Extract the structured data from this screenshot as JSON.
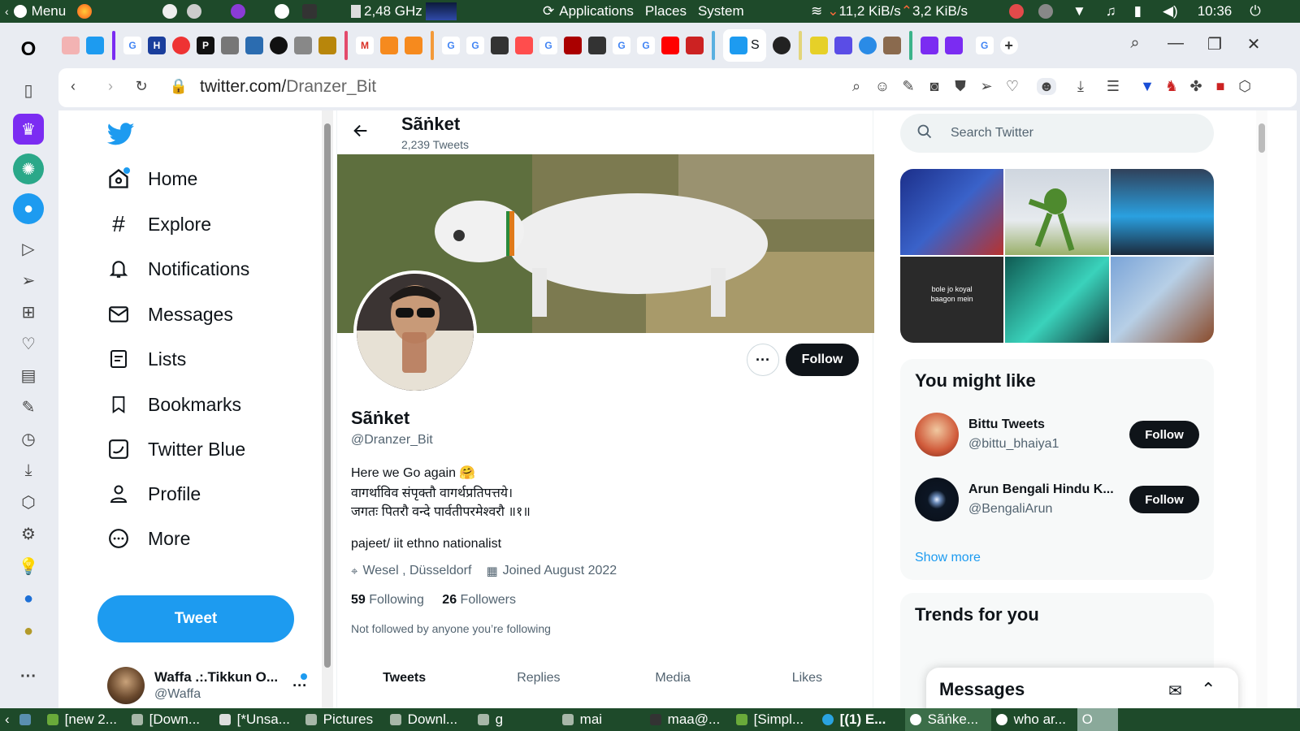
{
  "os_top": {
    "menu_label": "Menu",
    "cpu": "2,48 GHz",
    "applications": "Applications",
    "places": "Places",
    "system": "System",
    "net_down": "11,2 KiB/s",
    "net_up": "3,2 KiB/s",
    "clock": "10:36"
  },
  "browser": {
    "url_host": "twitter.com/",
    "url_path": "Dranzer_Bit",
    "active_tab_letter": "S"
  },
  "nav": {
    "items": [
      {
        "label": "Home",
        "icon": "home-icon"
      },
      {
        "label": "Explore",
        "icon": "hashtag-icon"
      },
      {
        "label": "Notifications",
        "icon": "bell-icon"
      },
      {
        "label": "Messages",
        "icon": "envelope-icon"
      },
      {
        "label": "Lists",
        "icon": "list-icon"
      },
      {
        "label": "Bookmarks",
        "icon": "bookmark-icon"
      },
      {
        "label": "Twitter Blue",
        "icon": "twitter-blue-icon"
      },
      {
        "label": "Profile",
        "icon": "person-icon"
      },
      {
        "label": "More",
        "icon": "more-circle-icon"
      }
    ],
    "tweet_button": "Tweet",
    "account_name": "Waffa .:.Tikkun O...",
    "account_handle": "@Waffa"
  },
  "profile": {
    "header_name": "Sãṅket",
    "tweet_count": "2,239 Tweets",
    "name": "Sãṅket",
    "handle": "@Dranzer_Bit",
    "follow_label": "Follow",
    "bio_line1": "Here we Go again 🤗",
    "bio_line2": "वागर्थाविव संपृक्तौ वागर्थप्रतिपत्तये।",
    "bio_line3": "जगतः पितरौ वन्दे पार्वतीपरमेश्वरौ ॥१॥",
    "bio_line4": "pajeet/ iit ethno nationalist",
    "location": "Wesel , Düsseldorf",
    "joined": "Joined August 2022",
    "following_count": "59",
    "following_label": "Following",
    "followers_count": "26",
    "followers_label": "Followers",
    "not_followed": "Not followed by anyone you’re following",
    "tabs": [
      "Tweets",
      "Replies",
      "Media",
      "Likes"
    ]
  },
  "right": {
    "search_placeholder": "Search Twitter",
    "media_caption_1": "bole jo koyal",
    "media_caption_2": "baagon mein",
    "wtf_title": "You might like",
    "suggestions": [
      {
        "name": "Bittu Tweets",
        "handle": "@bittu_bhaiya1",
        "follow": "Follow"
      },
      {
        "name": "Arun Bengali Hindu K...",
        "handle": "@BengaliArun",
        "follow": "Follow"
      }
    ],
    "show_more": "Show more",
    "trends_title": "Trends for you",
    "messages_drawer": "Messages"
  },
  "taskbar": {
    "items": [
      "[new 2...",
      "[Down...",
      "[*Unsa...",
      "Pictures",
      "Downl...",
      "g",
      "mai",
      "maa@...",
      "[Simpl...",
      "[(1) E...",
      "Sãṅke...",
      "who ar..."
    ]
  },
  "colors": {
    "twitter_blue": "#1d9bf0",
    "os_panel": "#1e4a2a",
    "text_primary": "#0f1419",
    "text_secondary": "#536471"
  }
}
